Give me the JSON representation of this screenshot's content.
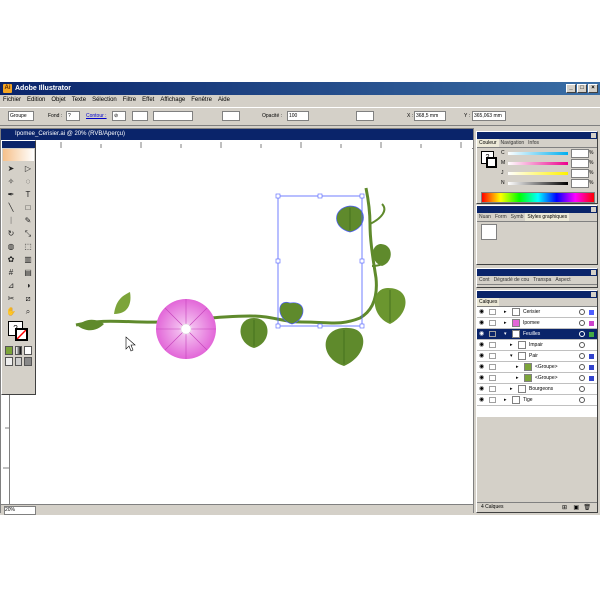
{
  "window": {
    "title": "Adobe Illustrator"
  },
  "menu": [
    "Fichier",
    "Edition",
    "Objet",
    "Texte",
    "Sélection",
    "Filtre",
    "Effet",
    "Affichage",
    "Fenêtre",
    "Aide"
  ],
  "control": {
    "selection_type": "Groupe",
    "fill_label": "Fond :",
    "stroke_label": "Contour :",
    "opacity_label": "Opacité :",
    "opacity_value": "100",
    "x_label": "X :",
    "x_value": "368,5 mm",
    "y_label": "Y :",
    "y_value": "365,063 mm"
  },
  "document": {
    "title": "Ipomee_Cerisier.ai @ 20% (RVB/Aperçu)",
    "zoom": "20%"
  },
  "color_panel": {
    "tabs": [
      "Couleur",
      "Navigation",
      "Infos"
    ],
    "channels": [
      "C",
      "M",
      "J",
      "N"
    ],
    "unit": "%"
  },
  "style_panel": {
    "tabs": [
      "Nuan",
      "Form",
      "Symb",
      "Styles graphiques"
    ]
  },
  "appearance_panel": {
    "tabs": [
      "Cont",
      "Dégradé de cou",
      "Transpa",
      "Aspect"
    ]
  },
  "layers_panel": {
    "tabs": [
      "Calques"
    ],
    "rows": [
      {
        "label": "Cerisier",
        "indent": 0,
        "color": "#4f5fff"
      },
      {
        "label": "Ipomee",
        "indent": 0,
        "color": "#cc44cc"
      },
      {
        "label": "Feuilles",
        "indent": 0,
        "color": "#44aa44",
        "selected": true
      },
      {
        "label": "Impair",
        "indent": 1,
        "color": "#44aa44"
      },
      {
        "label": "Pair",
        "indent": 1,
        "color": "#44aa44"
      },
      {
        "label": "<Groupe>",
        "indent": 2,
        "color": "#3344cc"
      },
      {
        "label": "<Groupe>",
        "indent": 2,
        "color": "#3344cc"
      },
      {
        "label": "Bourgeons",
        "indent": 1,
        "color": "#44aa44"
      },
      {
        "label": "Tige",
        "indent": 0,
        "color": "#44aa44"
      }
    ],
    "footer": "4 Calques"
  },
  "colors": {
    "leaf": "#5f8a2c",
    "leaf_dark": "#3f6b1c",
    "flower": "#e266d8",
    "selection": "#4f5fff"
  }
}
